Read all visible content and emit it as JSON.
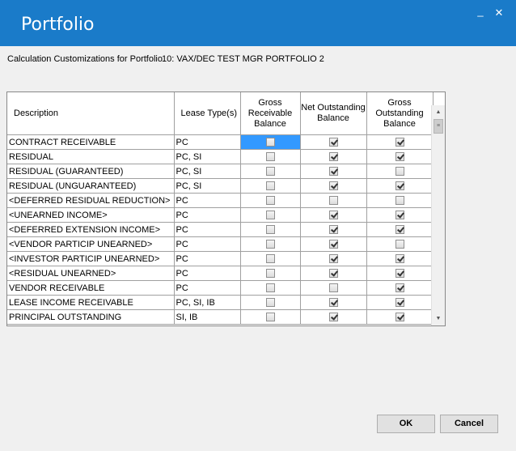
{
  "window": {
    "title": "Portfolio",
    "minimize_glyph": "_",
    "close_glyph": "✕"
  },
  "header": {
    "calc_label": "Calculation Customizations for Portfolio",
    "portfolio_name": "10: VAX/DEC TEST MGR PORTFOLIO 2"
  },
  "grid": {
    "columns": [
      {
        "label": "Description"
      },
      {
        "label": "Lease Type(s)"
      },
      {
        "label": "Gross Receivable Balance"
      },
      {
        "label": "Net Outstanding Balance"
      },
      {
        "label": "Gross Outstanding Balance"
      }
    ],
    "rows": [
      {
        "description": "CONTRACT RECEIVABLE",
        "lease_types": "PC",
        "gross_receivable": false,
        "net_outstanding": true,
        "gross_outstanding": true
      },
      {
        "description": "RESIDUAL",
        "lease_types": "PC, SI",
        "gross_receivable": false,
        "net_outstanding": true,
        "gross_outstanding": true
      },
      {
        "description": "RESIDUAL (GUARANTEED)",
        "lease_types": "PC, SI",
        "gross_receivable": false,
        "net_outstanding": true,
        "gross_outstanding": false
      },
      {
        "description": "RESIDUAL (UNGUARANTEED)",
        "lease_types": "PC, SI",
        "gross_receivable": false,
        "net_outstanding": true,
        "gross_outstanding": true
      },
      {
        "description": "<DEFERRED RESIDUAL REDUCTION>",
        "lease_types": "PC",
        "gross_receivable": false,
        "net_outstanding": false,
        "gross_outstanding": false
      },
      {
        "description": "<UNEARNED INCOME>",
        "lease_types": "PC",
        "gross_receivable": false,
        "net_outstanding": true,
        "gross_outstanding": true
      },
      {
        "description": "<DEFERRED EXTENSION INCOME>",
        "lease_types": "PC",
        "gross_receivable": false,
        "net_outstanding": true,
        "gross_outstanding": true
      },
      {
        "description": "<VENDOR PARTICIP UNEARNED>",
        "lease_types": "PC",
        "gross_receivable": false,
        "net_outstanding": true,
        "gross_outstanding": false
      },
      {
        "description": "<INVESTOR PARTICIP UNEARNED>",
        "lease_types": "PC",
        "gross_receivable": false,
        "net_outstanding": true,
        "gross_outstanding": true
      },
      {
        "description": "<RESIDUAL UNEARNED>",
        "lease_types": "PC",
        "gross_receivable": false,
        "net_outstanding": true,
        "gross_outstanding": true
      },
      {
        "description": "VENDOR RECEIVABLE",
        "lease_types": "PC",
        "gross_receivable": false,
        "net_outstanding": false,
        "gross_outstanding": true
      },
      {
        "description": "LEASE INCOME RECEIVABLE",
        "lease_types": "PC, SI, IB",
        "gross_receivable": false,
        "net_outstanding": true,
        "gross_outstanding": true
      },
      {
        "description": "PRINCIPAL OUTSTANDING",
        "lease_types": "SI, IB",
        "gross_receivable": false,
        "net_outstanding": true,
        "gross_outstanding": true
      }
    ],
    "selected_row": 0,
    "selected_column": "gross_receivable",
    "selection_color": "#3399ff"
  },
  "scrollbar": {
    "up_glyph": "▲",
    "down_glyph": "▼",
    "thumb_glyph": "≡"
  },
  "buttons": {
    "ok": "OK",
    "cancel": "Cancel"
  },
  "colors": {
    "titlebar": "#1a7bc9",
    "background": "#f0f0f0"
  }
}
